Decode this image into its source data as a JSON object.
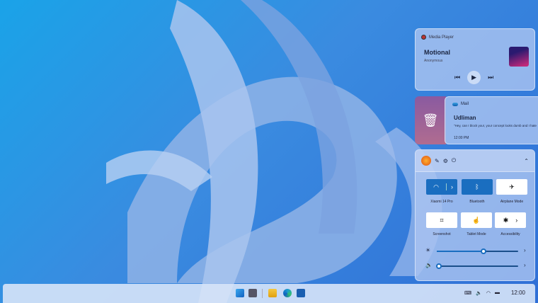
{
  "media": {
    "app": "Media Player",
    "title": "Motional",
    "artist": "Anonymous"
  },
  "mail": {
    "app": "Mail",
    "from": "Udliman",
    "body": "\"Hey, can I block you!, your concept looks dumb and I hate",
    "time": "12:00 PM"
  },
  "quick_settings": {
    "tiles": [
      {
        "label": "Xiaomi 14 Pro",
        "on": true
      },
      {
        "label": "Bluetooth",
        "on": true
      },
      {
        "label": "Airplane Mode",
        "on": false
      },
      {
        "label": "Screenshot",
        "on": false
      },
      {
        "label": "Tablet Mode",
        "on": false
      },
      {
        "label": "Accessibility",
        "on": false
      }
    ],
    "brightness_percent": 57,
    "volume_percent": 3
  },
  "taskbar": {
    "clock": "12:00"
  },
  "colors": {
    "accent": "#1a6ec0"
  }
}
